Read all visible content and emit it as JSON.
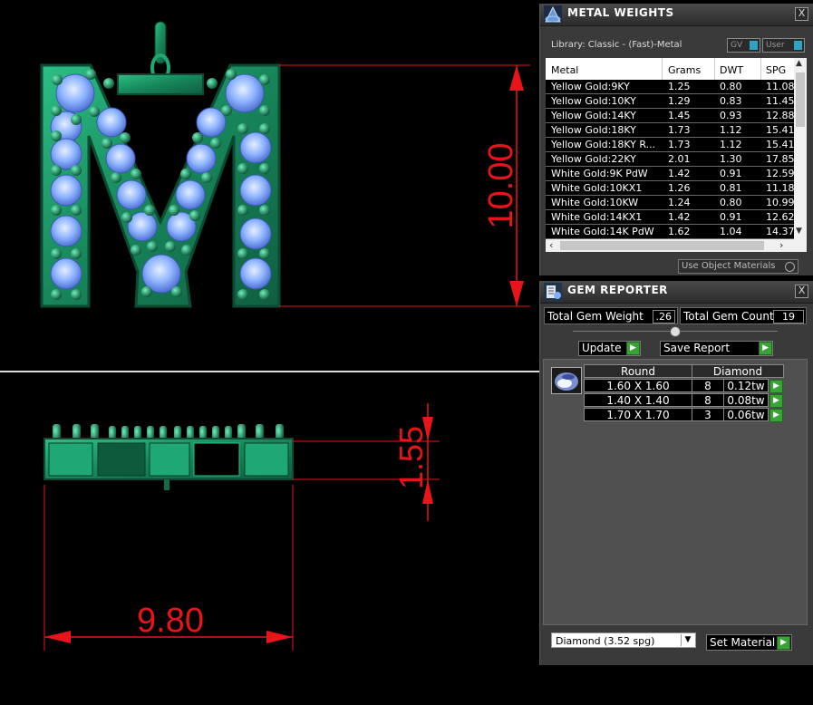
{
  "viewport": {
    "dimensions": {
      "height": "10.00",
      "depth": "1.55",
      "width": "9.80"
    },
    "colors": {
      "dimension": "#e8141a",
      "metal": "#1f9e6c",
      "gem": "#8fb6ff"
    }
  },
  "metal_weights": {
    "title": "METAL WEIGHTS",
    "close": "X",
    "library": "Library: Classic - (Fast)-Metal",
    "toggle_gv": "GV",
    "toggle_user": "User",
    "columns": [
      "Metal",
      "Grams",
      "DWT",
      "SPG"
    ],
    "rows": [
      [
        "Yellow Gold:9KY",
        "1.25",
        "0.80",
        "11.08"
      ],
      [
        "Yellow Gold:10KY",
        "1.29",
        "0.83",
        "11.45"
      ],
      [
        "Yellow Gold:14KY",
        "1.45",
        "0.93",
        "12.88"
      ],
      [
        "Yellow Gold:18KY",
        "1.73",
        "1.12",
        "15.41"
      ],
      [
        "Yellow Gold:18KY R...",
        "1.73",
        "1.12",
        "15.41"
      ],
      [
        "Yellow Gold:22KY",
        "2.01",
        "1.30",
        "17.85"
      ],
      [
        "White Gold:9K PdW",
        "1.42",
        "0.91",
        "12.59"
      ],
      [
        "White Gold:10KX1",
        "1.26",
        "0.81",
        "11.18"
      ],
      [
        "White Gold:10KW",
        "1.24",
        "0.80",
        "10.99"
      ],
      [
        "White Gold:14KX1",
        "1.42",
        "0.91",
        "12.62"
      ],
      [
        "White Gold:14K PdW",
        "1.62",
        "1.04",
        "14.37"
      ]
    ],
    "use_object_materials": "Use Object Materials"
  },
  "gem_reporter": {
    "title": "GEM REPORTER",
    "close": "X",
    "total_weight_label": "Total Gem Weight",
    "total_weight_value": ".26",
    "total_count_label": "Total Gem Count",
    "total_count_value": "19",
    "update_label": "Update",
    "save_report_label": "Save Report",
    "table_headers": [
      "Round",
      "Diamond"
    ],
    "rows": [
      {
        "size": "1.60 X 1.60",
        "count": "8",
        "weight": "0.12tw"
      },
      {
        "size": "1.40 X 1.40",
        "count": "8",
        "weight": "0.08tw"
      },
      {
        "size": "1.70 X 1.70",
        "count": "3",
        "weight": "0.06tw"
      }
    ],
    "material_select": "Diamond     (3.52 spg)",
    "set_material_label": "Set Material"
  }
}
